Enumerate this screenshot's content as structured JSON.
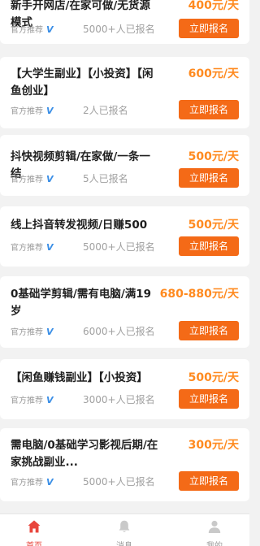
{
  "accent_color": "#f46a17",
  "price_color": "#ff8a1f",
  "listings": [
    {
      "title": "新手开网店/在家可做/无货源模式",
      "price": "400元/天",
      "official": "官方推荐",
      "badge_icon": "verified-v-icon",
      "count": "5000+人已报名",
      "button": "立即报名"
    },
    {
      "title": "【大学生副业】【小投资】【闲鱼创业】",
      "price": "600元/天",
      "official": "官方推荐",
      "badge_icon": "verified-v-icon",
      "count": "2人已报名",
      "button": "立即报名"
    },
    {
      "title": "抖快视频剪辑/在家做/一条一结",
      "price": "500元/天",
      "official": "官方推荐",
      "badge_icon": "verified-v-icon",
      "count": "5人已报名",
      "button": "立即报名"
    },
    {
      "title": "线上抖音转发视频/日赚500",
      "price": "500元/天",
      "official": "官方推荐",
      "badge_icon": "verified-v-icon",
      "count": "5000+人已报名",
      "button": "立即报名"
    },
    {
      "title": "0基础学剪辑/需有电脑/满19岁",
      "price": "680-880元/天",
      "official": "官方推荐",
      "badge_icon": "verified-v-icon",
      "count": "6000+人已报名",
      "button": "立即报名"
    },
    {
      "title": "【闲鱼赚钱副业】【小投资】",
      "price": "500元/天",
      "official": "官方推荐",
      "badge_icon": "verified-v-icon",
      "count": "3000+人已报名",
      "button": "立即报名"
    },
    {
      "title": "需电脑/0基础学习影视后期/在家挑战副业...",
      "price": "300元/天",
      "official": "官方推荐",
      "badge_icon": "verified-v-icon",
      "count": "5000+人已报名",
      "button": "立即报名"
    }
  ],
  "tabbar": {
    "active": "home",
    "items": [
      {
        "id": "home",
        "label": "首页",
        "icon": "home-icon"
      },
      {
        "id": "messages",
        "label": "消息",
        "icon": "bell-icon"
      },
      {
        "id": "mine",
        "label": "我的",
        "icon": "user-icon"
      }
    ]
  }
}
